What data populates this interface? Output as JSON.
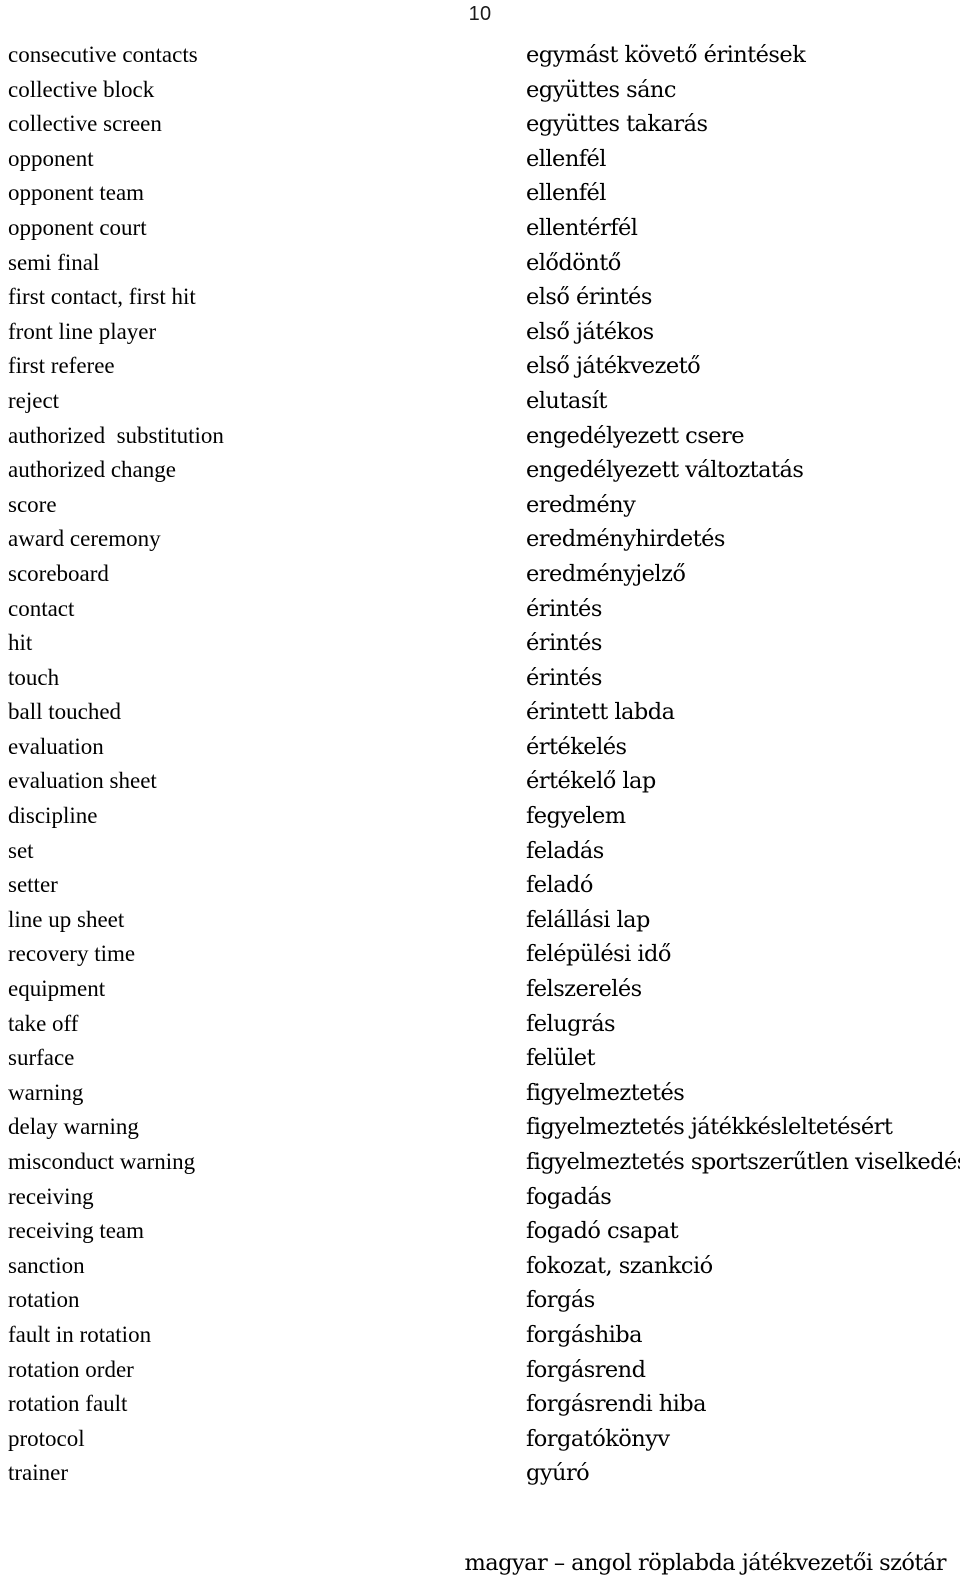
{
  "document": {
    "page_number": "10",
    "footer": "magyar – angol röplabda játékvezetői szótár",
    "columns": {
      "left_language": "english",
      "right_language": "hungarian"
    }
  },
  "entries": [
    {
      "en": "consecutive contacts",
      "hu": "egymást követő érintések"
    },
    {
      "en": "collective block",
      "hu": "együttes sánc"
    },
    {
      "en": "collective screen",
      "hu": "együttes takarás"
    },
    {
      "en": "opponent",
      "hu": "ellenfél"
    },
    {
      "en": "opponent team",
      "hu": "ellenfél"
    },
    {
      "en": "opponent court",
      "hu": "ellentérfél"
    },
    {
      "en": "semi final",
      "hu": "elődöntő"
    },
    {
      "en": "first contact, first hit",
      "hu": "első érintés"
    },
    {
      "en": "front line player",
      "hu": "első játékos"
    },
    {
      "en": "first referee",
      "hu": "első játékvezető"
    },
    {
      "en": "reject",
      "hu": "elutasít"
    },
    {
      "en": "authorized  substitution",
      "hu": "engedélyezett csere"
    },
    {
      "en": "authorized change",
      "hu": "engedélyezett változtatás"
    },
    {
      "en": "score",
      "hu": "eredmény"
    },
    {
      "en": "award ceremony",
      "hu": "eredményhirdetés"
    },
    {
      "en": "scoreboard",
      "hu": "eredményjelző"
    },
    {
      "en": "contact",
      "hu": "érintés"
    },
    {
      "en": "hit",
      "hu": "érintés"
    },
    {
      "en": "touch",
      "hu": "érintés"
    },
    {
      "en": "ball touched",
      "hu": "érintett labda"
    },
    {
      "en": "evaluation",
      "hu": "értékelés"
    },
    {
      "en": "evaluation sheet",
      "hu": "értékelő lap"
    },
    {
      "en": "discipline",
      "hu": "fegyelem"
    },
    {
      "en": "set",
      "hu": "feladás"
    },
    {
      "en": "setter",
      "hu": "feladó"
    },
    {
      "en": "line up sheet",
      "hu": "felállási lap"
    },
    {
      "en": "recovery time",
      "hu": "felépülési idő"
    },
    {
      "en": "equipment",
      "hu": "felszerelés"
    },
    {
      "en": "take off",
      "hu": "felugrás"
    },
    {
      "en": "surface",
      "hu": "felület"
    },
    {
      "en": "warning",
      "hu": "figyelmeztetés"
    },
    {
      "en": "delay warning",
      "hu": "figyelmeztetés játékkésleltetésért"
    },
    {
      "en": "misconduct warning",
      "hu": "figyelmeztetés sportszerűtlen viselkedésért"
    },
    {
      "en": "receiving",
      "hu": "fogadás"
    },
    {
      "en": "receiving team",
      "hu": "fogadó csapat"
    },
    {
      "en": "sanction",
      "hu": "fokozat, szankció"
    },
    {
      "en": "rotation",
      "hu": "forgás"
    },
    {
      "en": "fault in rotation",
      "hu": "forgáshiba"
    },
    {
      "en": "rotation order",
      "hu": "forgásrend"
    },
    {
      "en": "rotation fault",
      "hu": "forgásrendi hiba"
    },
    {
      "en": "protocol",
      "hu": "forgatókönyv"
    },
    {
      "en": "trainer",
      "hu": "gyúró"
    }
  ]
}
